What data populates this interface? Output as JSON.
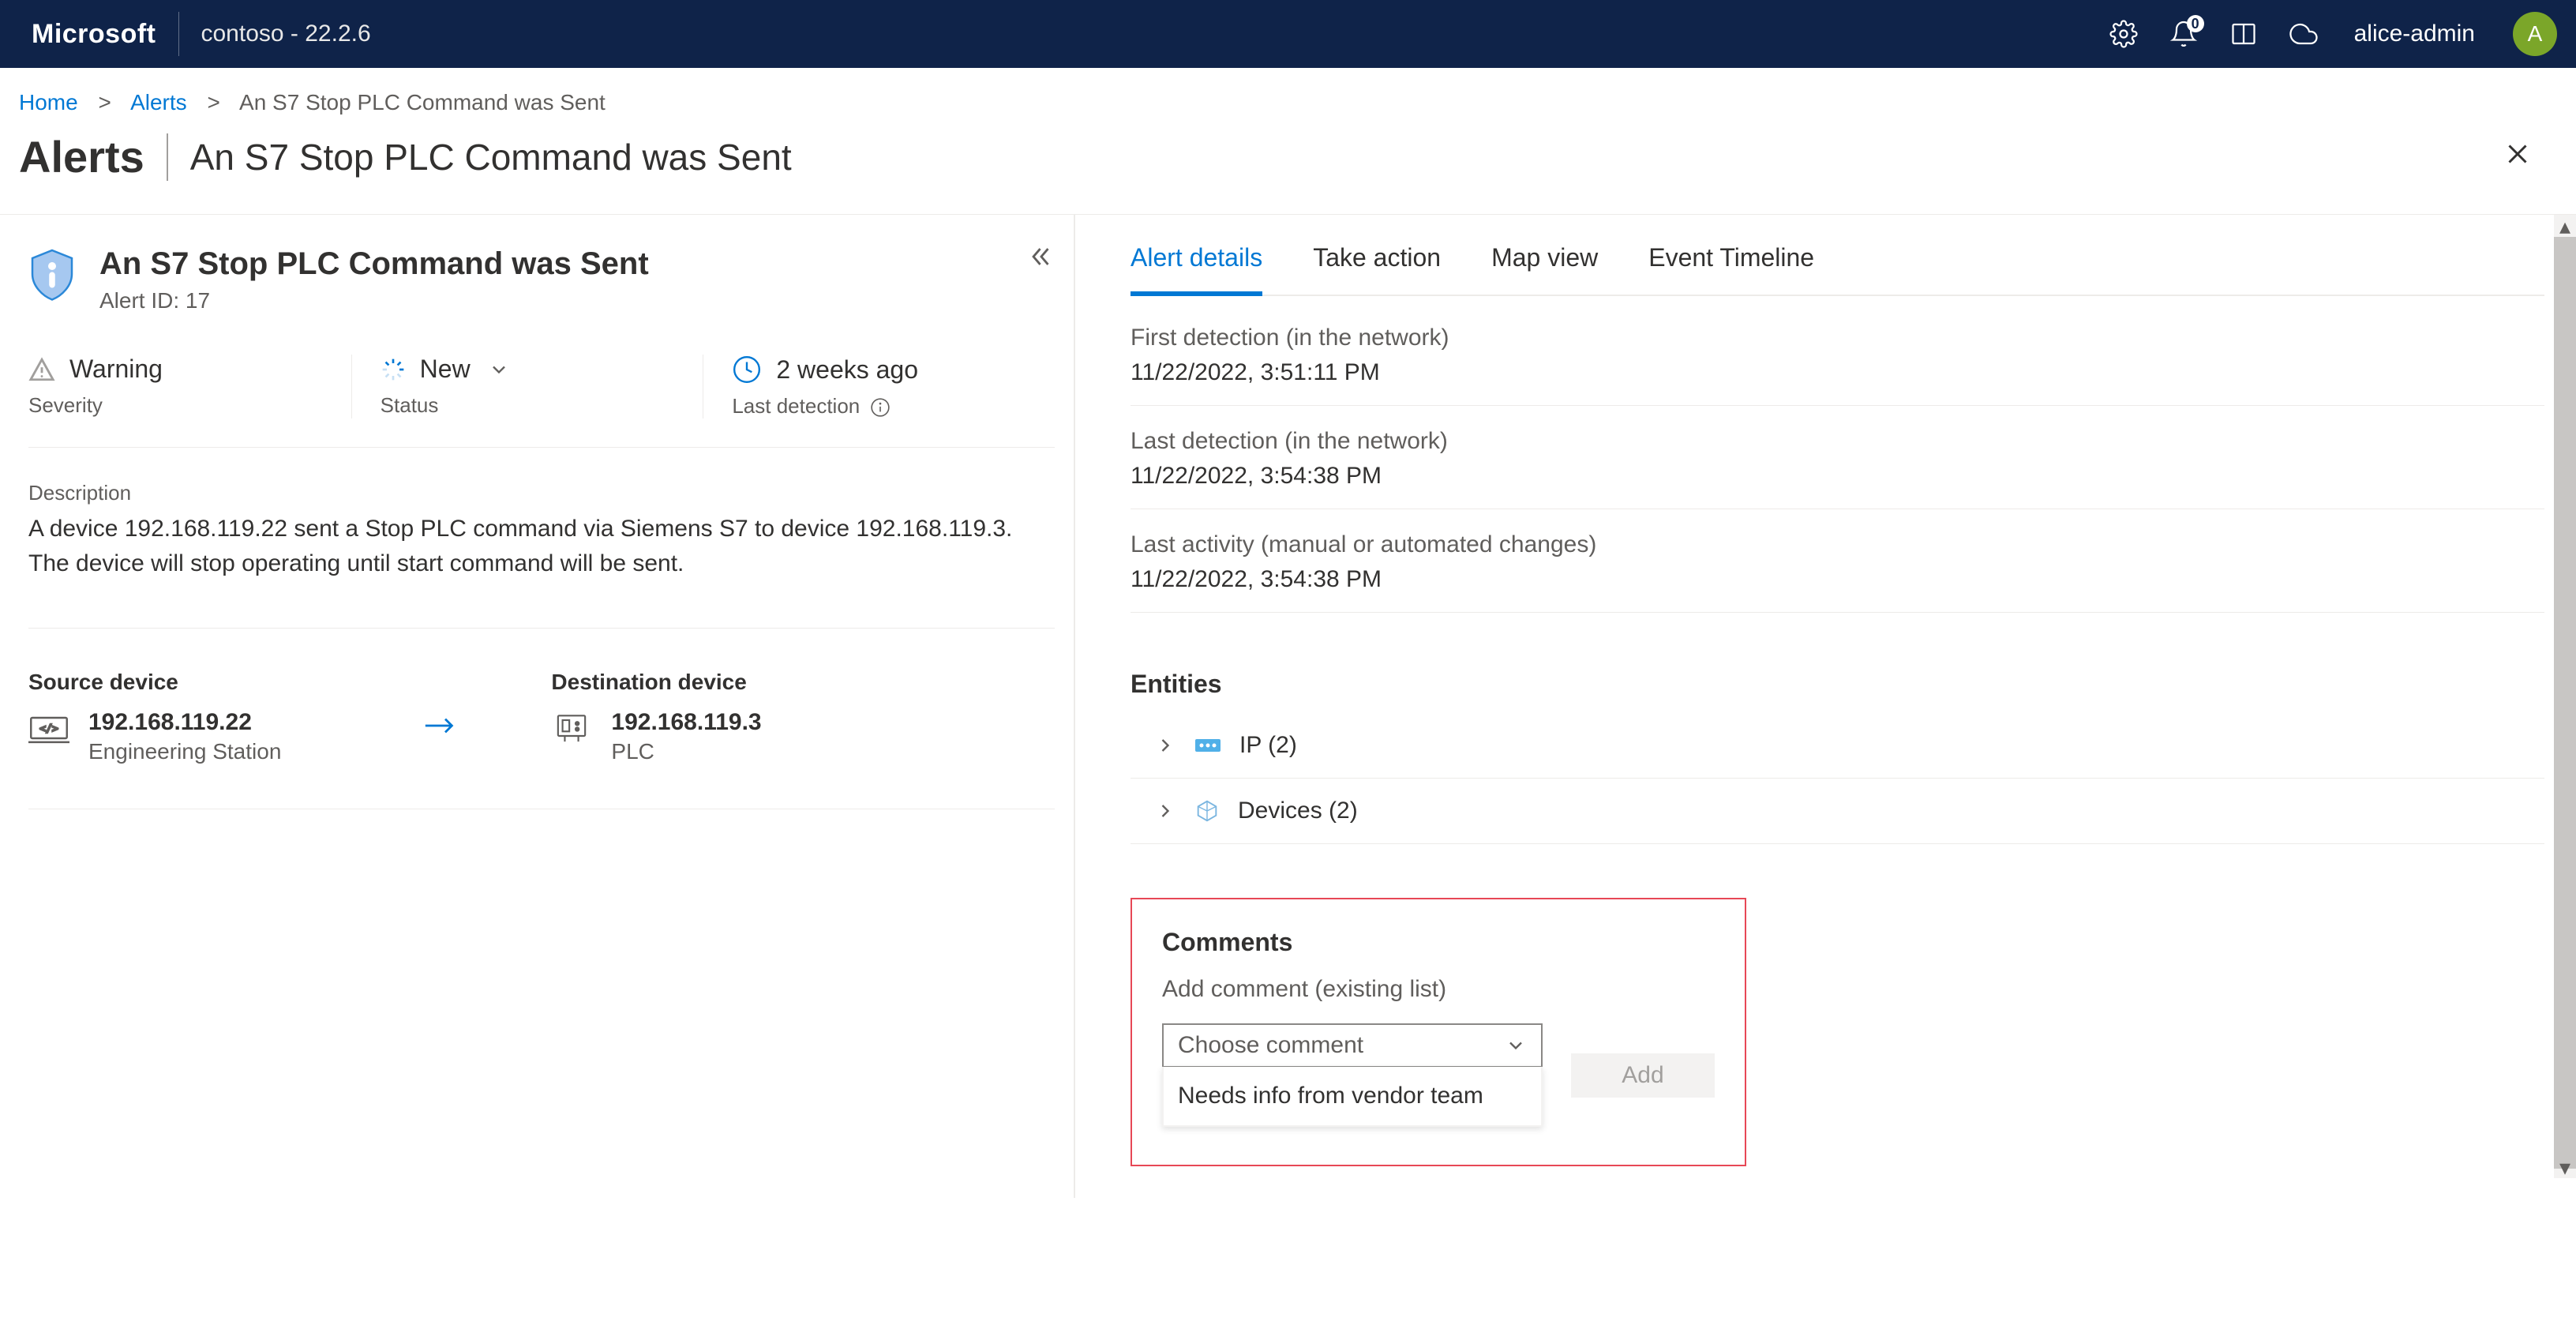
{
  "topbar": {
    "brand": "Microsoft",
    "tenant": "contoso - 22.2.6",
    "notification_count": "0",
    "username": "alice-admin",
    "avatar_initial": "A"
  },
  "breadcrumb": {
    "home": "Home",
    "alerts": "Alerts",
    "current": "An S7 Stop PLC Command was Sent"
  },
  "page": {
    "title": "Alerts",
    "subtitle": "An S7 Stop PLC Command was Sent"
  },
  "alert": {
    "title": "An S7 Stop PLC Command was Sent",
    "id_label": "Alert ID: 17",
    "severity_value": "Warning",
    "severity_label": "Severity",
    "status_value": "New",
    "status_label": "Status",
    "last_detection_value": "2 weeks ago",
    "last_detection_label": "Last detection",
    "description_label": "Description",
    "description_text": "A device 192.168.119.22 sent a Stop PLC command via Siemens S7 to device 192.168.119.3. The device will stop operating until start command will be sent.",
    "source_label": "Source device",
    "source_ip": "192.168.119.22",
    "source_type": "Engineering Station",
    "dest_label": "Destination device",
    "dest_ip": "192.168.119.3",
    "dest_type": "PLC"
  },
  "tabs": {
    "details": "Alert details",
    "action": "Take action",
    "map": "Map view",
    "timeline": "Event Timeline"
  },
  "details": {
    "first_detection_label": "First detection (in the network)",
    "first_detection_value": "11/22/2022, 3:51:11 PM",
    "last_detection_label": "Last detection (in the network)",
    "last_detection_value": "11/22/2022, 3:54:38 PM",
    "last_activity_label": "Last activity (manual or automated changes)",
    "last_activity_value": "11/22/2022, 3:54:38 PM"
  },
  "entities": {
    "title": "Entities",
    "ip_label": "IP (2)",
    "devices_label": "Devices (2)"
  },
  "comments": {
    "title": "Comments",
    "add_label": "Add comment (existing list)",
    "placeholder": "Choose comment",
    "add_button": "Add",
    "dropdown_option": "Needs info from vendor team"
  }
}
